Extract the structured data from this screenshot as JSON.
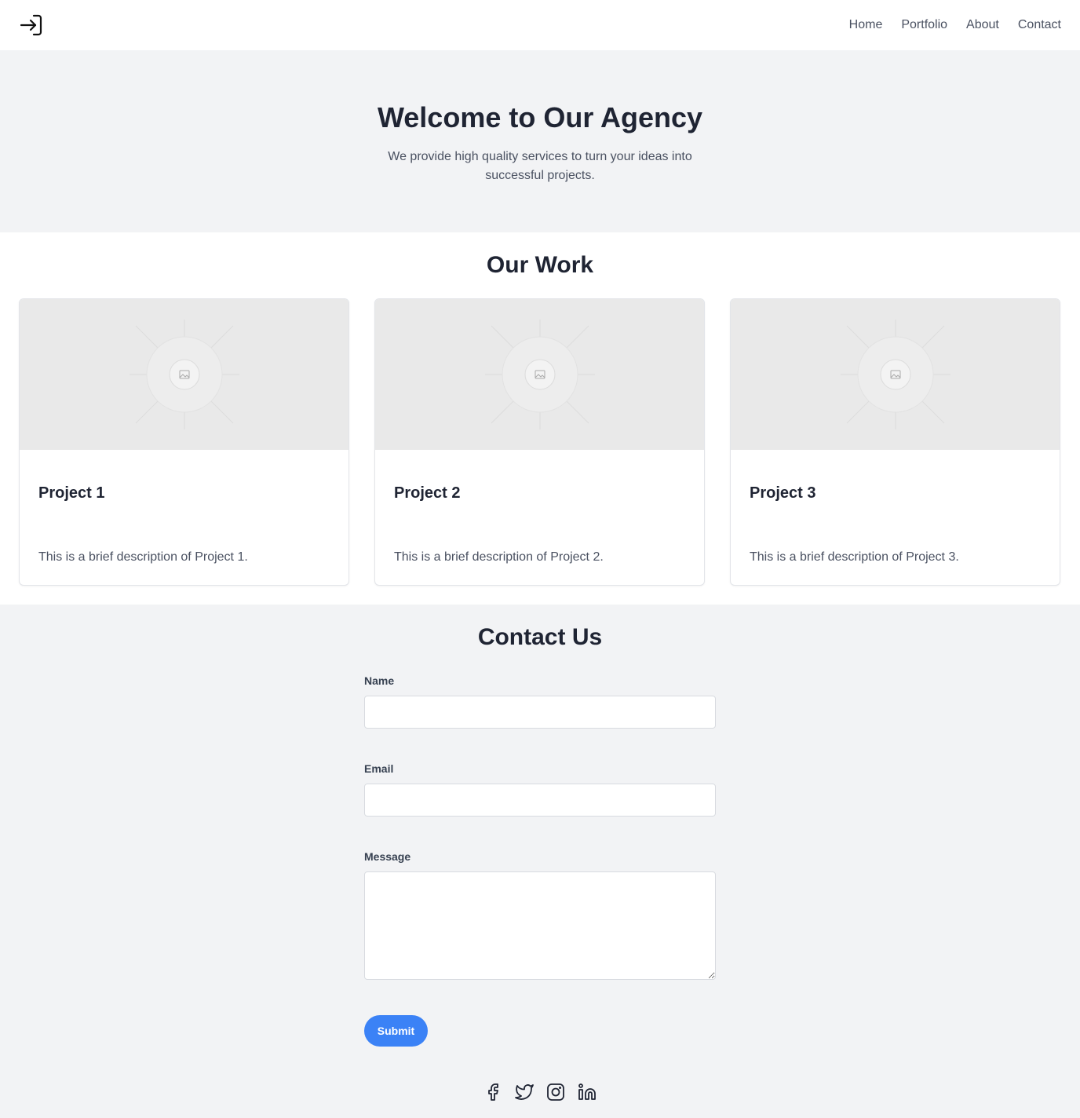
{
  "header": {
    "logo_icon": "login-arrow-icon",
    "nav": [
      "Home",
      "Portfolio",
      "About",
      "Contact"
    ]
  },
  "hero": {
    "title": "Welcome to Our Agency",
    "subtitle": "We provide high quality services to turn your ideas into successful projects."
  },
  "work": {
    "title": "Our Work",
    "projects": [
      {
        "title": "Project 1",
        "description": "This is a brief description of Project 1.",
        "image_icon": "image-placeholder-icon"
      },
      {
        "title": "Project 2",
        "description": "This is a brief description of Project 2.",
        "image_icon": "image-placeholder-icon"
      },
      {
        "title": "Project 3",
        "description": "This is a brief description of Project 3.",
        "image_icon": "image-placeholder-icon"
      }
    ]
  },
  "contact": {
    "title": "Contact Us",
    "name_label": "Name",
    "name_value": "",
    "email_label": "Email",
    "email_value": "",
    "message_label": "Message",
    "message_value": "",
    "submit_label": "Submit"
  },
  "socials": [
    "facebook-icon",
    "twitter-icon",
    "instagram-icon",
    "linkedin-icon"
  ],
  "colors": {
    "accent": "#3b82f6",
    "text_dark": "#1f2433",
    "text_muted": "#4a5161",
    "background": "#f2f3f5",
    "surface": "#ffffff"
  }
}
